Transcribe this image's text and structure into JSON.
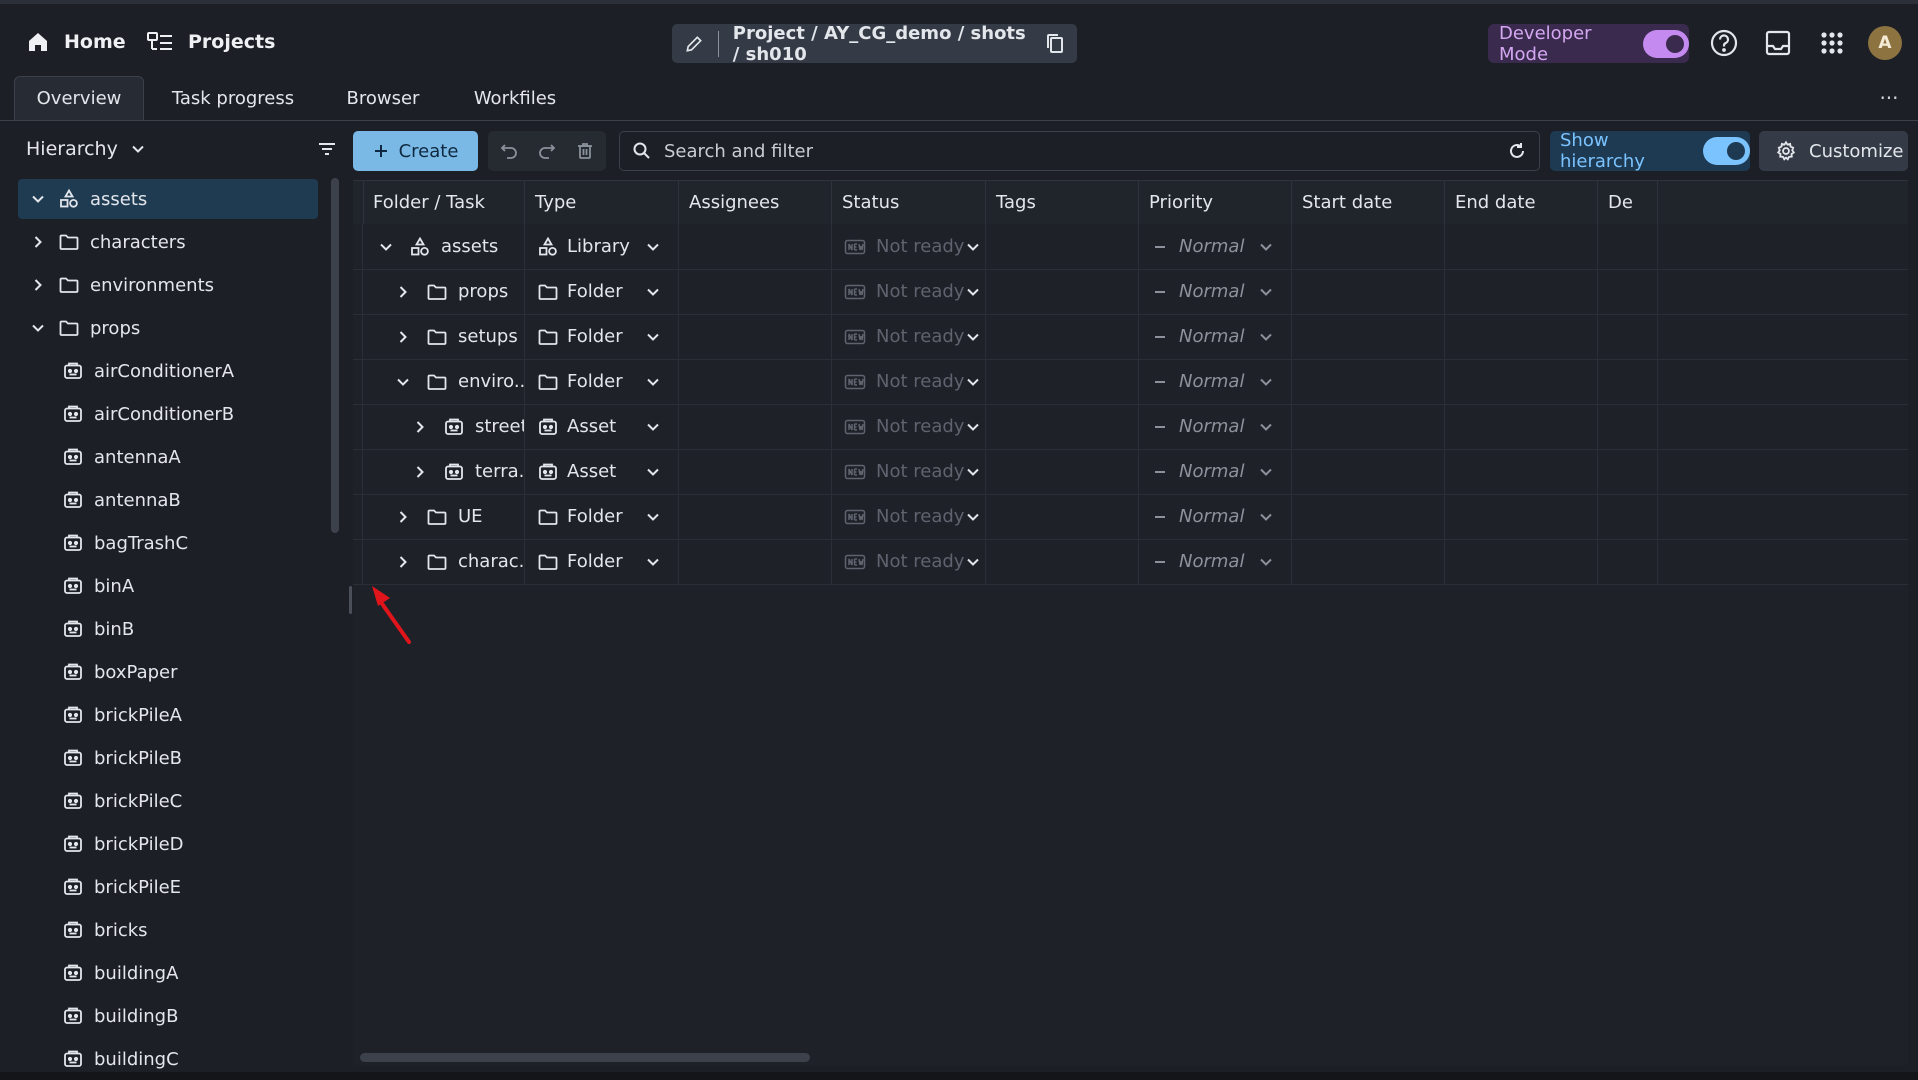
{
  "topbar": {
    "home_label": "Home",
    "projects_label": "Projects",
    "breadcrumb": "Project / AY_CG_demo / shots / sh010",
    "developer_mode_label": "Developer Mode",
    "developer_mode_on": true,
    "avatar_initial": "A"
  },
  "tabs": [
    {
      "label": "Overview",
      "active": true
    },
    {
      "label": "Task progress",
      "active": false
    },
    {
      "label": "Browser",
      "active": false
    },
    {
      "label": "Workfiles",
      "active": false
    }
  ],
  "more_label": "···",
  "left_panel": {
    "hierarchy_label": "Hierarchy",
    "tree": [
      {
        "label": "assets",
        "icon": "library-icon",
        "chev": "down",
        "depth": 0,
        "selected": true
      },
      {
        "label": "characters",
        "icon": "folder-icon",
        "chev": "right",
        "depth": 0
      },
      {
        "label": "environments",
        "icon": "folder-icon",
        "chev": "right",
        "depth": 0
      },
      {
        "label": "props",
        "icon": "folder-icon",
        "chev": "down",
        "depth": 0
      },
      {
        "label": "airConditionerA",
        "icon": "asset-icon",
        "depth": 1
      },
      {
        "label": "airConditionerB",
        "icon": "asset-icon",
        "depth": 1
      },
      {
        "label": "antennaA",
        "icon": "asset-icon",
        "depth": 1
      },
      {
        "label": "antennaB",
        "icon": "asset-icon",
        "depth": 1
      },
      {
        "label": "bagTrashC",
        "icon": "asset-icon",
        "depth": 1
      },
      {
        "label": "binA",
        "icon": "asset-icon",
        "depth": 1
      },
      {
        "label": "binB",
        "icon": "asset-icon",
        "depth": 1
      },
      {
        "label": "boxPaper",
        "icon": "asset-icon",
        "depth": 1
      },
      {
        "label": "brickPileA",
        "icon": "asset-icon",
        "depth": 1
      },
      {
        "label": "brickPileB",
        "icon": "asset-icon",
        "depth": 1
      },
      {
        "label": "brickPileC",
        "icon": "asset-icon",
        "depth": 1
      },
      {
        "label": "brickPileD",
        "icon": "asset-icon",
        "depth": 1
      },
      {
        "label": "brickPileE",
        "icon": "asset-icon",
        "depth": 1
      },
      {
        "label": "bricks",
        "icon": "asset-icon",
        "depth": 1
      },
      {
        "label": "buildingA",
        "icon": "asset-icon",
        "depth": 1
      },
      {
        "label": "buildingB",
        "icon": "asset-icon",
        "depth": 1
      },
      {
        "label": "buildingC",
        "icon": "asset-icon",
        "depth": 1
      }
    ]
  },
  "toolbar": {
    "create_label": "Create",
    "search_placeholder": "Search and filter",
    "show_hierarchy_label": "Show hierarchy",
    "show_hierarchy_on": true,
    "customize_label": "Customize"
  },
  "grid": {
    "columns": [
      "Folder / Task",
      "Type",
      "Assignees",
      "Status",
      "Tags",
      "Priority",
      "Start date",
      "End date",
      "De"
    ],
    "rows": [
      {
        "name": "assets",
        "icon": "library-icon",
        "chev": "down",
        "depth": 0,
        "type": "Library",
        "type_icon": "library-icon",
        "status": "Not ready",
        "priority": "Normal"
      },
      {
        "name": "props",
        "icon": "folder-icon",
        "chev": "right",
        "depth": 1,
        "type": "Folder",
        "type_icon": "folder-icon",
        "status": "Not ready",
        "priority": "Normal"
      },
      {
        "name": "setups",
        "icon": "folder-icon",
        "chev": "right",
        "depth": 1,
        "type": "Folder",
        "type_icon": "folder-icon",
        "status": "Not ready",
        "priority": "Normal"
      },
      {
        "name": "enviro...",
        "icon": "folder-icon",
        "chev": "down",
        "depth": 1,
        "type": "Folder",
        "type_icon": "folder-icon",
        "status": "Not ready",
        "priority": "Normal"
      },
      {
        "name": "street",
        "icon": "asset-icon",
        "chev": "right",
        "depth": 2,
        "type": "Asset",
        "type_icon": "asset-icon",
        "status": "Not ready",
        "priority": "Normal"
      },
      {
        "name": "terra...",
        "icon": "asset-icon",
        "chev": "right",
        "depth": 2,
        "type": "Asset",
        "type_icon": "asset-icon",
        "status": "Not ready",
        "priority": "Normal"
      },
      {
        "name": "UE",
        "icon": "folder-icon",
        "chev": "right",
        "depth": 1,
        "type": "Folder",
        "type_icon": "folder-icon",
        "status": "Not ready",
        "priority": "Normal"
      },
      {
        "name": "charac...",
        "icon": "folder-icon",
        "chev": "right",
        "depth": 1,
        "type": "Folder",
        "type_icon": "folder-icon",
        "status": "Not ready",
        "priority": "Normal"
      }
    ]
  },
  "colors": {
    "background": "#1c1f25",
    "accent": "#7ab8e6",
    "developer_mode": "#c58af0",
    "selected_row": "#1f3b52",
    "annotation_arrow": "#e0141b"
  }
}
